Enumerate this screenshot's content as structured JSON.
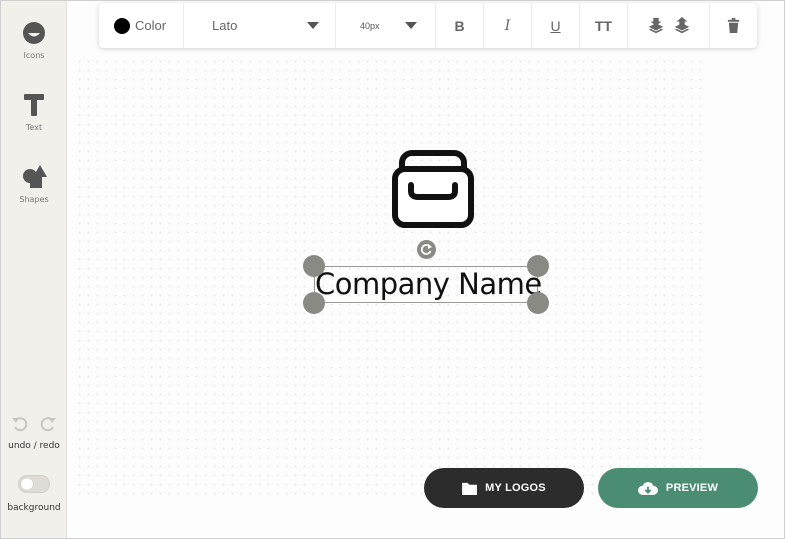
{
  "sidebar": {
    "tools": [
      {
        "label": "Icons",
        "icon": "smiley-icon"
      },
      {
        "label": "Text",
        "icon": "text-t-icon"
      },
      {
        "label": "Shapes",
        "icon": "shapes-icon"
      }
    ],
    "undo_redo_label": "undo / redo",
    "background_label": "background",
    "background_enabled": false
  },
  "toolbar": {
    "color_label": "Color",
    "color_value": "#000000",
    "font_family": "Lato",
    "font_size": "40px",
    "bold_label": "B",
    "italic_label": "I",
    "underline_label": "U",
    "uppercase_label": "TT"
  },
  "canvas": {
    "logo_icon": "briefcase-icon",
    "company_name": "Company Name"
  },
  "actions": {
    "my_logos_label": "MY LOGOS",
    "preview_label": "PREVIEW"
  },
  "colors": {
    "sidebar_bg": "#f1f0ea",
    "my_logos_bg": "#2c2c2c",
    "preview_bg": "#4a8d72",
    "handle": "#8a8a85"
  }
}
